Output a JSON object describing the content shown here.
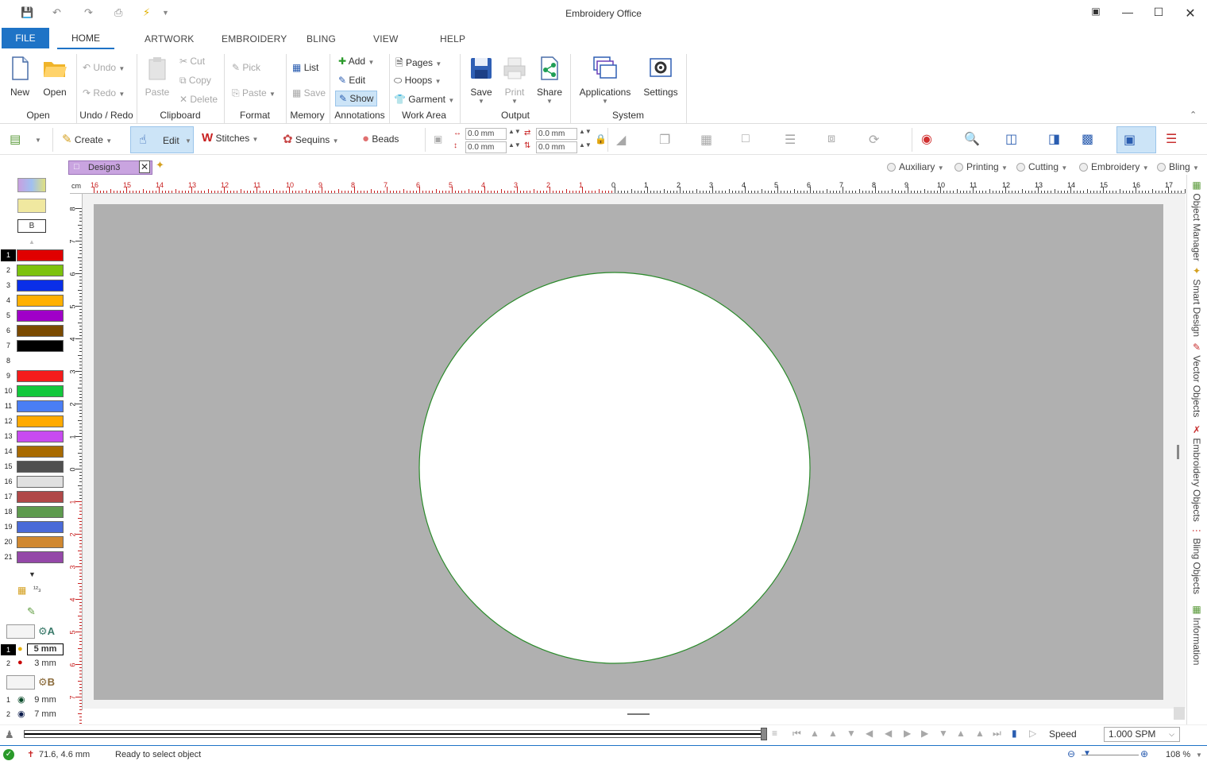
{
  "window": {
    "title": "Embroidery Office"
  },
  "tabs": [
    "FILE",
    "HOME",
    "ARTWORK",
    "EMBROIDERY",
    "BLING",
    "VIEW",
    "HELP"
  ],
  "ribbon": {
    "open_group": {
      "label": "Open",
      "new": "New",
      "open": "Open"
    },
    "undo_group": {
      "label": "Undo / Redo",
      "undo": "Undo",
      "redo": "Redo"
    },
    "clipboard_group": {
      "label": "Clipboard",
      "paste": "Paste",
      "cut": "Cut",
      "copy": "Copy",
      "delete": "Delete"
    },
    "format_group": {
      "label": "Format",
      "pick": "Pick",
      "paste": "Paste"
    },
    "memory_group": {
      "label": "Memory",
      "list": "List",
      "save": "Save"
    },
    "annotations_group": {
      "label": "Annotations",
      "add": "Add",
      "edit": "Edit",
      "show": "Show"
    },
    "workarea_group": {
      "label": "Work Area",
      "pages": "Pages",
      "hoops": "Hoops",
      "garment": "Garment"
    },
    "output_group": {
      "label": "Output",
      "save": "Save",
      "print": "Print",
      "share": "Share"
    },
    "system_group": {
      "label": "System",
      "applications": "Applications",
      "settings": "Settings"
    }
  },
  "toolbar": {
    "create": "Create",
    "edit": "Edit",
    "stitches": "Stitches",
    "sequins": "Sequins",
    "beads": "Beads",
    "x": "0.0 mm",
    "y": "0.0 mm",
    "w": "0.0 mm",
    "h": "0.0 mm"
  },
  "document": {
    "tab": "Design3",
    "filters": [
      "Auxiliary",
      "Printing",
      "Cutting",
      "Embroidery",
      "Bling"
    ]
  },
  "ruler": {
    "unit": "cm",
    "h_labels": [
      "16",
      "15",
      "14",
      "13",
      "12",
      "11",
      "10",
      "9",
      "8",
      "7",
      "6",
      "5",
      "4",
      "3",
      "2",
      "1",
      "0",
      "1",
      "2",
      "3",
      "4",
      "5",
      "6",
      "7",
      "8",
      "9",
      "10",
      "11",
      "12",
      "13",
      "14",
      "15",
      "16",
      "17"
    ],
    "v_labels": [
      "8",
      "7",
      "6",
      "5",
      "4",
      "3",
      "2",
      "1",
      "0",
      "1",
      "2",
      "3",
      "4",
      "5",
      "6",
      "7"
    ]
  },
  "palette": {
    "selector": "B",
    "colors": [
      {
        "n": "1",
        "hex": "#e00000"
      },
      {
        "n": "2",
        "hex": "#7cc20c"
      },
      {
        "n": "3",
        "hex": "#0a2fe8"
      },
      {
        "n": "4",
        "hex": "#ffb000"
      },
      {
        "n": "5",
        "hex": "#a000c8"
      },
      {
        "n": "6",
        "hex": "#7a4a00"
      },
      {
        "n": "7",
        "hex": "#000000"
      },
      {
        "n": "8",
        "hex": "#ffffff"
      },
      {
        "n": "9",
        "hex": "#f51c1c"
      },
      {
        "n": "10",
        "hex": "#12c83c"
      },
      {
        "n": "11",
        "hex": "#4a7ef5"
      },
      {
        "n": "12",
        "hex": "#ffaa00"
      },
      {
        "n": "13",
        "hex": "#c84af0"
      },
      {
        "n": "14",
        "hex": "#a86a00"
      },
      {
        "n": "15",
        "hex": "#505050"
      },
      {
        "n": "16",
        "hex": "#e0e0e0"
      },
      {
        "n": "17",
        "hex": "#b04848"
      },
      {
        "n": "18",
        "hex": "#5e9a4e"
      },
      {
        "n": "19",
        "hex": "#4a6ad8"
      },
      {
        "n": "20",
        "hex": "#d08830"
      },
      {
        "n": "21",
        "hex": "#9448a8"
      }
    ],
    "set_a_label": "A",
    "set_a": [
      {
        "n": "1",
        "size": "5 mm"
      },
      {
        "n": "2",
        "size": "3 mm"
      }
    ],
    "set_b_label": "B",
    "set_b": [
      {
        "n": "1",
        "size": "9 mm"
      },
      {
        "n": "2",
        "size": "7 mm"
      }
    ]
  },
  "right_panels": [
    "Object Manager",
    "Smart Design",
    "Vector Objects",
    "Embroidery Objects",
    "Bling Objects",
    "Information"
  ],
  "playback": {
    "speed_label": "Speed",
    "speed_value": "1.000 SPM"
  },
  "status": {
    "coords": "71.6, 4.6 mm",
    "message": "Ready to select object",
    "zoom": "108 %"
  },
  "colors": {
    "accent": "#1e73c6",
    "hoop_bg": "#b0b0b0",
    "circle_stroke": "#2a8a2a"
  }
}
